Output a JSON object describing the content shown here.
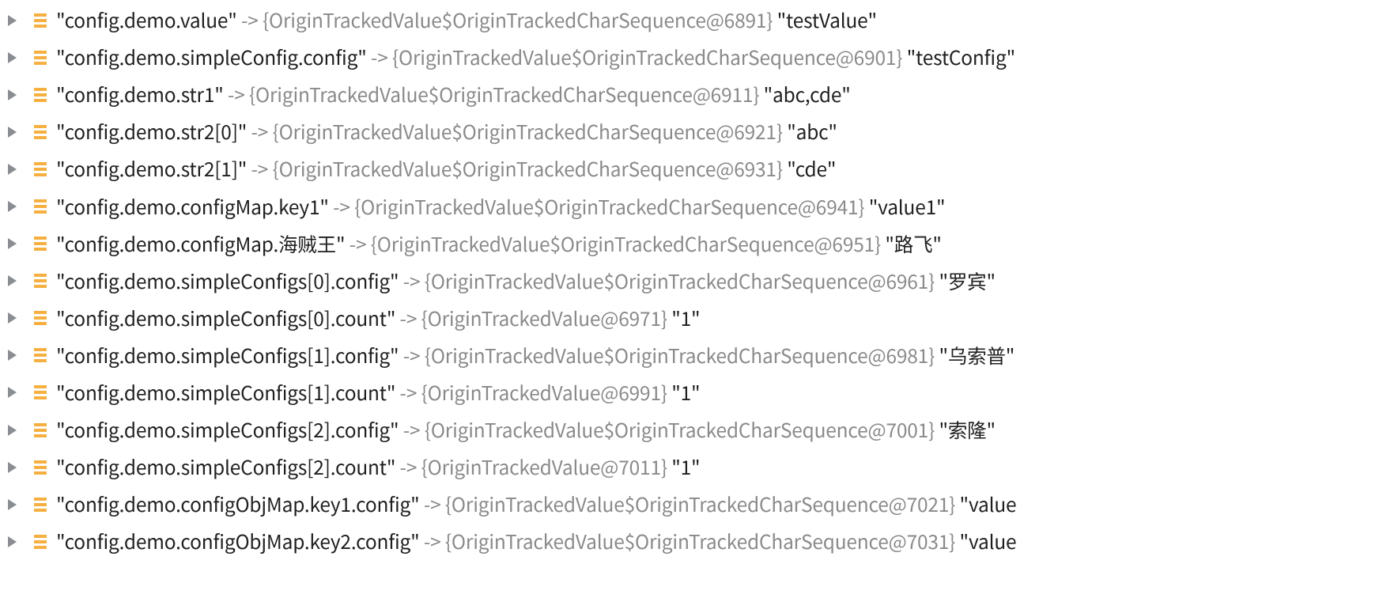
{
  "arrow_text": " -> ",
  "entries": [
    {
      "key": "\"config.demo.value\"",
      "ref": "{OriginTrackedValue$OriginTrackedCharSequence@6891}",
      "val": " \"testValue\""
    },
    {
      "key": "\"config.demo.simpleConfig.config\"",
      "ref": "{OriginTrackedValue$OriginTrackedCharSequence@6901}",
      "val": " \"testConfig\""
    },
    {
      "key": "\"config.demo.str1\"",
      "ref": "{OriginTrackedValue$OriginTrackedCharSequence@6911}",
      "val": " \"abc,cde\""
    },
    {
      "key": "\"config.demo.str2[0]\"",
      "ref": "{OriginTrackedValue$OriginTrackedCharSequence@6921}",
      "val": " \"abc\""
    },
    {
      "key": "\"config.demo.str2[1]\"",
      "ref": "{OriginTrackedValue$OriginTrackedCharSequence@6931}",
      "val": " \"cde\""
    },
    {
      "key": "\"config.demo.configMap.key1\"",
      "ref": "{OriginTrackedValue$OriginTrackedCharSequence@6941}",
      "val": " \"value1\""
    },
    {
      "key": "\"config.demo.configMap.海贼王\"",
      "ref": "{OriginTrackedValue$OriginTrackedCharSequence@6951}",
      "val": " \"路飞\""
    },
    {
      "key": "\"config.demo.simpleConfigs[0].config\"",
      "ref": "{OriginTrackedValue$OriginTrackedCharSequence@6961}",
      "val": " \"罗宾\""
    },
    {
      "key": "\"config.demo.simpleConfigs[0].count\"",
      "ref": "{OriginTrackedValue@6971}",
      "val": " \"1\""
    },
    {
      "key": "\"config.demo.simpleConfigs[1].config\"",
      "ref": "{OriginTrackedValue$OriginTrackedCharSequence@6981}",
      "val": " \"乌索普\""
    },
    {
      "key": "\"config.demo.simpleConfigs[1].count\"",
      "ref": "{OriginTrackedValue@6991}",
      "val": " \"1\""
    },
    {
      "key": "\"config.demo.simpleConfigs[2].config\"",
      "ref": "{OriginTrackedValue$OriginTrackedCharSequence@7001}",
      "val": " \"索隆\""
    },
    {
      "key": "\"config.demo.simpleConfigs[2].count\"",
      "ref": "{OriginTrackedValue@7011}",
      "val": " \"1\""
    },
    {
      "key": "\"config.demo.configObjMap.key1.config\"",
      "ref": "{OriginTrackedValue$OriginTrackedCharSequence@7021}",
      "val": " \"value"
    },
    {
      "key": "\"config.demo.configObjMap.key2.config\"",
      "ref": "{OriginTrackedValue$OriginTrackedCharSequence@7031}",
      "val": " \"value"
    }
  ]
}
